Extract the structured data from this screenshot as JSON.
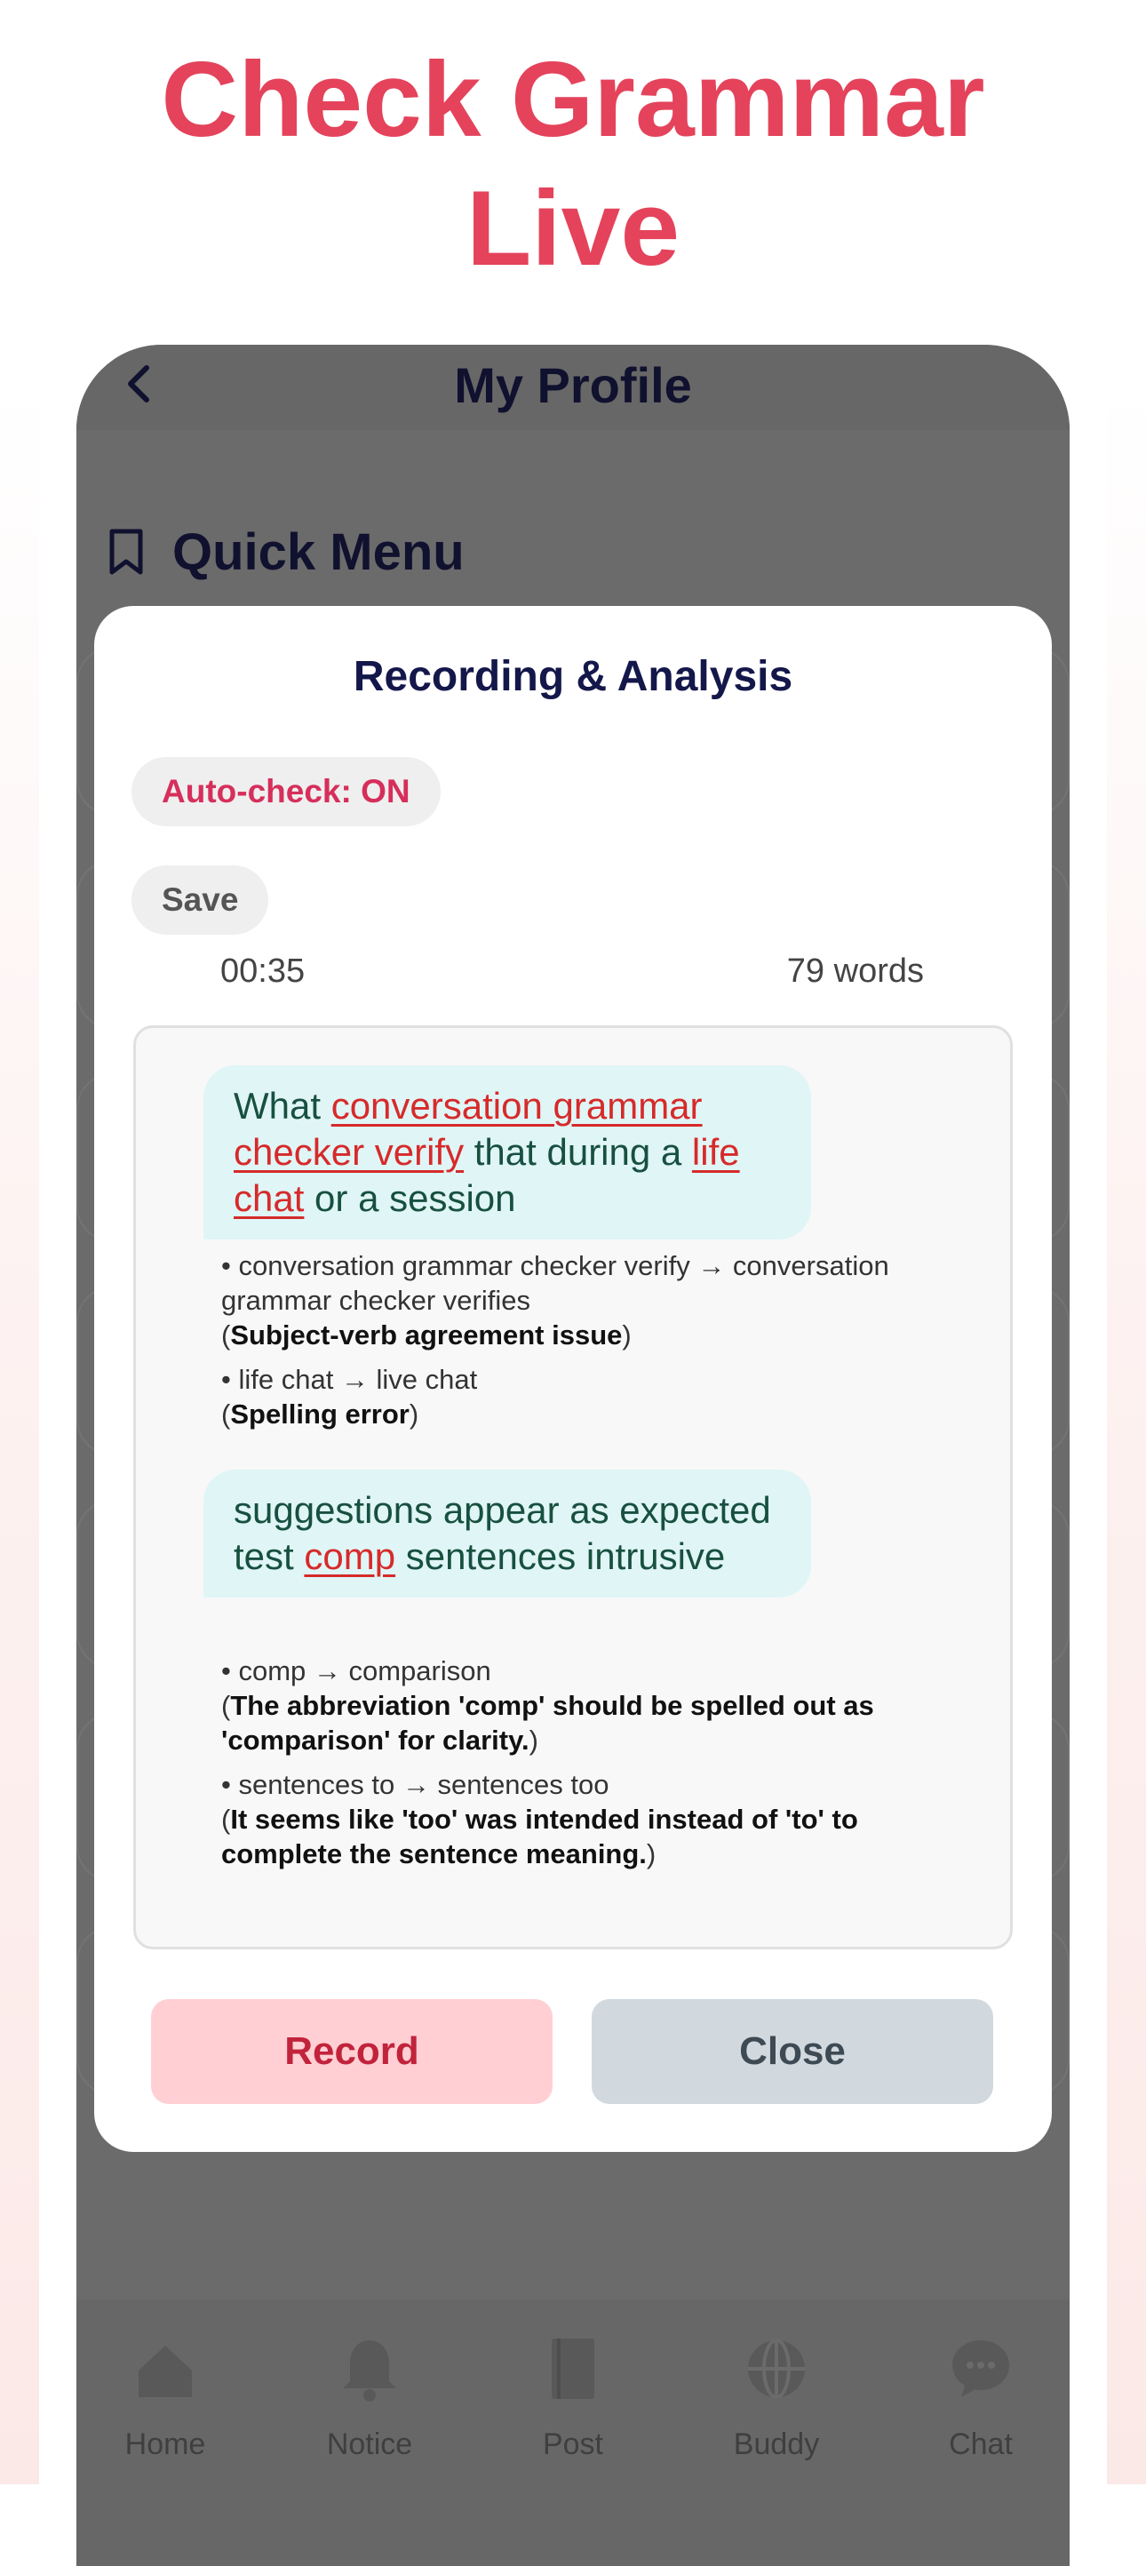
{
  "headline": {
    "line1": "Check Grammar",
    "line2": "Live"
  },
  "phone": {
    "title": "My Profile",
    "quick_menu_label": "Quick Menu"
  },
  "modal": {
    "title": "Recording & Analysis",
    "auto_check_label": "Auto-check: ON",
    "save_label": "Save",
    "timer": "00:35",
    "word_count": "79 words",
    "record_label": "Record",
    "close_label": "Close"
  },
  "transcript": {
    "entries": [
      {
        "segments": [
          {
            "text": "What ",
            "error": false
          },
          {
            "text": "conversation grammar checker verify",
            "error": true
          },
          {
            "text": " that during a ",
            "error": false
          },
          {
            "text": "life chat",
            "error": true
          },
          {
            "text": " or a session",
            "error": false
          }
        ],
        "corrections": [
          {
            "change": "• conversation grammar checker verify → conversation grammar checker verifies",
            "reason": "Subject-verb agreement issue"
          },
          {
            "change": "• life chat → live chat",
            "reason": "Spelling error"
          }
        ]
      },
      {
        "segments": [
          {
            "text": "suggestions appear as expected test ",
            "error": false
          },
          {
            "text": "comp",
            "error": true
          },
          {
            "text": " sentences intrusive",
            "error": false
          }
        ],
        "corrections": [
          {
            "change": "• comp → comparison",
            "reason": "The abbreviation 'comp' should be spelled out as 'comparison' for clarity."
          },
          {
            "change": "• sentences to → sentences too",
            "reason": "It seems like 'too' was intended instead of 'to' to complete the sentence meaning."
          }
        ]
      }
    ]
  },
  "bottom_nav": {
    "items": [
      {
        "label": "Home",
        "icon": "home-icon"
      },
      {
        "label": "Notice",
        "icon": "bell-icon"
      },
      {
        "label": "Post",
        "icon": "book-icon"
      },
      {
        "label": "Buddy",
        "icon": "globe-icon"
      },
      {
        "label": "Chat",
        "icon": "chat-bubble-icon"
      }
    ]
  },
  "colors": {
    "headline": "#e4435b",
    "error": "#d62a2a",
    "bubble": "#e0f5f6",
    "record_bg": "#ffcfd4",
    "close_bg": "#d1d9df",
    "overlay": "#6b6b6b"
  }
}
